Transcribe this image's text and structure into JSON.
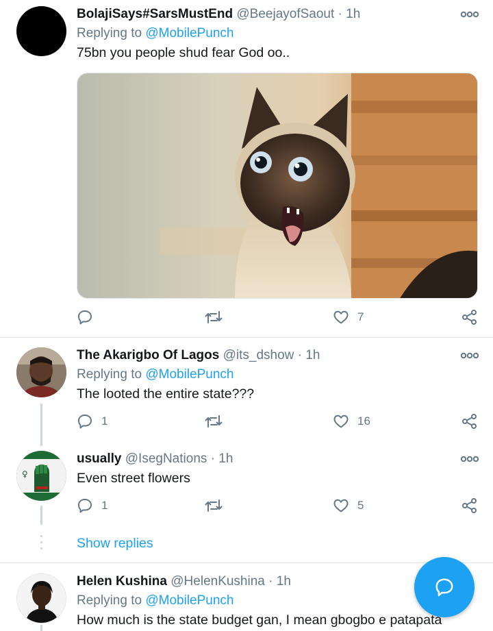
{
  "tweets": [
    {
      "name": "BolajiSays#SarsMustEnd",
      "handle": "@BeejayofSaout",
      "time": "1h",
      "replying_prefix": "Replying to",
      "replying_to": "@MobilePunch",
      "text": "75bn you people shud fear God oo..",
      "replies": "",
      "retweets": "",
      "likes": "7",
      "has_image": true,
      "image_description": "siamese-cat-shocked-photo"
    },
    {
      "name": "The Akarigbo Of Lagos",
      "handle": "@its_dshow",
      "time": "1h",
      "replying_prefix": "Replying to",
      "replying_to": "@MobilePunch",
      "text": "The looted the entire state???",
      "replies": "1",
      "retweets": "",
      "likes": "16"
    },
    {
      "name": "usually",
      "handle": "@IsegNations",
      "time": "1h",
      "text": "Even street flowers",
      "replies": "1",
      "retweets": "",
      "likes": "5"
    },
    {
      "name": "Helen Kushina",
      "handle": "@HelenKushina",
      "time": "1h",
      "replying_prefix": "Replying to",
      "replying_to": "@MobilePunch",
      "text": "How much is the state budget gan, I mean gbogbo e patapata"
    }
  ],
  "show_replies_label": "Show replies",
  "separator": "·",
  "icons": {
    "reply": "reply-icon",
    "retweet": "retweet-icon",
    "like": "heart-icon",
    "share": "share-icon",
    "more": "more-options-icon",
    "compose": "compose-reply-icon"
  },
  "colors": {
    "accent": "#1da1f2",
    "secondary_text": "#657786",
    "divider": "#e1e8ed",
    "icon": "#657786"
  }
}
